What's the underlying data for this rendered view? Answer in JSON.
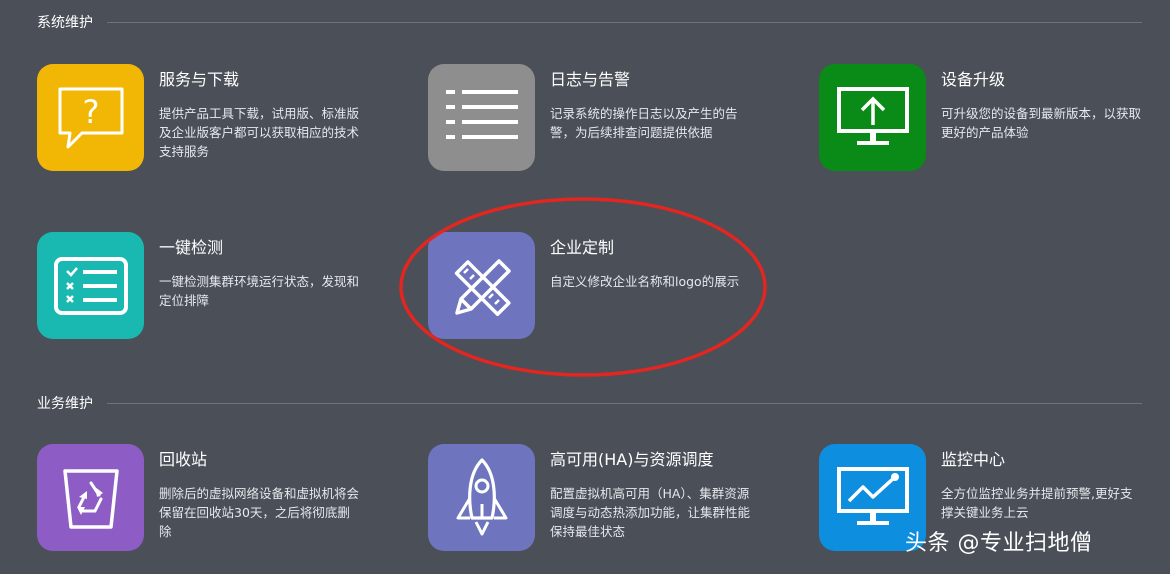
{
  "sections": {
    "system": {
      "title": "系统维护"
    },
    "business": {
      "title": "业务维护"
    }
  },
  "cards": {
    "service_download": {
      "title": "服务与下载",
      "desc": "提供产品工具下载，试用版、标准版及企业版客户都可以获取相应的技术支持服务",
      "icon": "question-chat-icon",
      "color": "#f2b705"
    },
    "log_alarm": {
      "title": "日志与告警",
      "desc": "记录系统的操作日志以及产生的告警，为后续排查问题提供依据",
      "icon": "list-icon",
      "color": "#8e8e8e"
    },
    "upgrade": {
      "title": "设备升级",
      "desc": "可升级您的设备到最新版本，以获取更好的产品体验",
      "icon": "monitor-upload-icon",
      "color": "#0a8a16"
    },
    "one_click_check": {
      "title": "一键检测",
      "desc": "一键检测集群环境运行状态，发现和定位排障",
      "icon": "checklist-icon",
      "color": "#19b9b1"
    },
    "enterprise_custom": {
      "title": "企业定制",
      "desc": "自定义修改企业名称和logo的展示",
      "icon": "pencil-ruler-icon",
      "color": "#6e74bd"
    },
    "recycle_bin": {
      "title": "回收站",
      "desc": "删除后的虚拟网络设备和虚拟机将会保留在回收站30天，之后将彻底删除",
      "icon": "recycle-bin-icon",
      "color": "#8d5cc4"
    },
    "ha_scheduling": {
      "title": "高可用(HA)与资源调度",
      "desc": "配置虚拟机高可用（HA）、集群资源调度与动态热添加功能，让集群性能保持最佳状态",
      "icon": "rocket-icon",
      "color": "#6e74bd"
    },
    "monitor_center": {
      "title": "监控中心",
      "desc": "全方位监控业务并提前预警,更好支撑关键业务上云",
      "icon": "monitor-chart-icon",
      "color": "#0d8ede"
    }
  },
  "annotation": {
    "color": "#e3261f"
  },
  "watermark": {
    "text": "头条 @专业扫地僧"
  }
}
